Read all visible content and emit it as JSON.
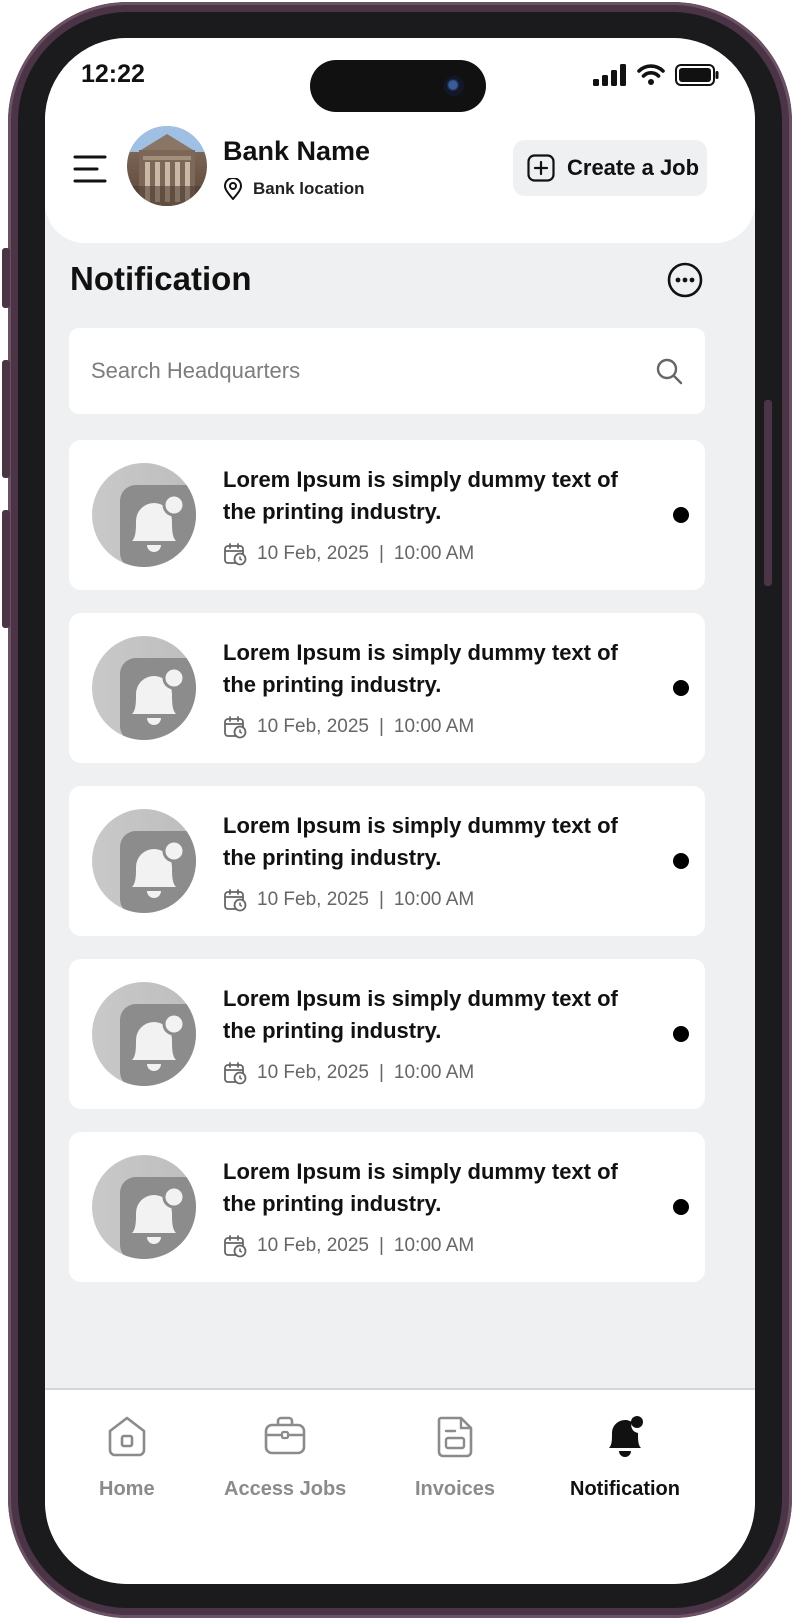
{
  "status_bar": {
    "time": "12:22"
  },
  "header": {
    "bank_name": "Bank Name",
    "bank_location": "Bank location",
    "create_job_label": "Create a Job"
  },
  "page": {
    "title": "Notification"
  },
  "search": {
    "placeholder": "Search Headquarters",
    "value": ""
  },
  "notifications": [
    {
      "text": "Lorem Ipsum is simply dummy text of the printing industry.",
      "date": "10 Feb, 2025",
      "separator": "|",
      "time": "10:00 AM",
      "unread": true
    },
    {
      "text": "Lorem Ipsum is simply dummy text of the printing industry.",
      "date": "10 Feb, 2025",
      "separator": "|",
      "time": "10:00 AM",
      "unread": true
    },
    {
      "text": "Lorem Ipsum is simply dummy text of the printing industry.",
      "date": "10 Feb, 2025",
      "separator": "|",
      "time": "10:00 AM",
      "unread": true
    },
    {
      "text": "Lorem Ipsum is simply dummy text of the printing industry.",
      "date": "10 Feb, 2025",
      "separator": "|",
      "time": "10:00 AM",
      "unread": true
    },
    {
      "text": "Lorem Ipsum is simply dummy text of the printing industry.",
      "date": "10 Feb, 2025",
      "separator": "|",
      "time": "10:00 AM",
      "unread": true
    }
  ],
  "tabbar": {
    "tabs": [
      {
        "label": "Home",
        "icon": "home-icon",
        "active": false
      },
      {
        "label": "Access Jobs",
        "icon": "briefcase-icon",
        "active": false
      },
      {
        "label": "Invoices",
        "icon": "invoice-icon",
        "active": false
      },
      {
        "label": "Notification",
        "icon": "bell-icon",
        "active": true
      }
    ]
  },
  "colors": {
    "screen_bg": "#eff0f2",
    "card_bg": "#ffffff",
    "text_primary": "#111111",
    "text_muted": "#8b8b8b",
    "frame": "#4a3446"
  }
}
